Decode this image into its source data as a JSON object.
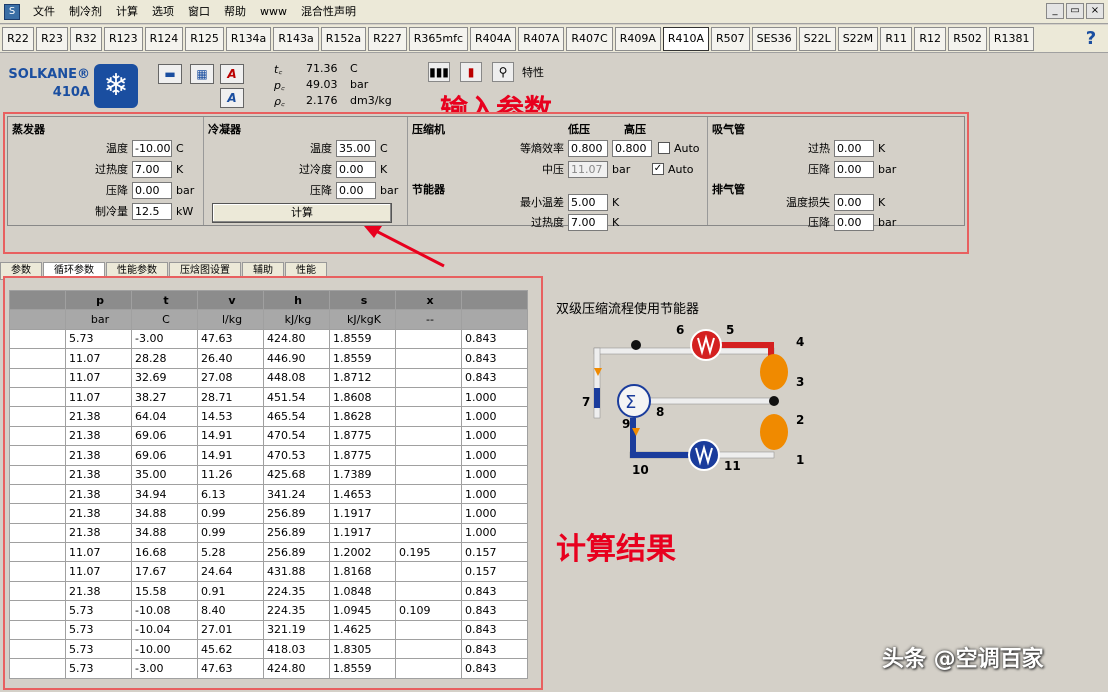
{
  "menu": {
    "items": [
      "文件",
      "制冷剂",
      "计算",
      "选项",
      "窗口",
      "帮助",
      "www",
      "混合性声明"
    ],
    "window_buttons": [
      "_",
      "▭",
      "×"
    ]
  },
  "refrigerants": {
    "tabs": [
      "R22",
      "R23",
      "R32",
      "R123",
      "R124",
      "R125",
      "R134a",
      "R143a",
      "R152a",
      "R227",
      "R365mfc",
      "R404A",
      "R407A",
      "R407C",
      "R409A",
      "R410A",
      "R507",
      "SES36",
      "S22L",
      "S22M",
      "R11",
      "R12",
      "R502",
      "R1381"
    ],
    "active": "R410A",
    "help": "?"
  },
  "header": {
    "brand": "SOLKANE®",
    "model": "410A",
    "logo_glyph": "❄",
    "props": [
      {
        "sym": "t꜀",
        "val": "71.36",
        "unit": "C"
      },
      {
        "sym": "p꜀",
        "val": "49.03",
        "unit": "bar"
      },
      {
        "sym": "ρ꜀",
        "val": "2.176",
        "unit": "dm3/kg"
      }
    ],
    "right_label": "特性"
  },
  "annotations": {
    "input": "输入参数",
    "result": "计算结果"
  },
  "input": {
    "evaporator": {
      "title": "蒸发器",
      "fields": [
        {
          "label": "温度",
          "value": "-10.00",
          "unit": "C"
        },
        {
          "label": "过热度",
          "value": "7.00",
          "unit": "K"
        },
        {
          "label": "压降",
          "value": "0.00",
          "unit": "bar"
        },
        {
          "label": "制冷量",
          "value": "12.5",
          "unit": "kW"
        }
      ]
    },
    "condenser": {
      "title": "冷凝器",
      "fields": [
        {
          "label": "温度",
          "value": "35.00",
          "unit": "C"
        },
        {
          "label": "过冷度",
          "value": "0.00",
          "unit": "K"
        },
        {
          "label": "压降",
          "value": "0.00",
          "unit": "bar"
        }
      ],
      "calc_button": "计算"
    },
    "compressor": {
      "title": "压缩机",
      "low_label": "低压",
      "high_label": "高压",
      "efficiency_label": "等熵效率",
      "low_value": "0.800",
      "high_value": "0.800",
      "auto1": "Auto",
      "mid_label": "中压",
      "mid_value": "11.07",
      "mid_unit": "bar",
      "auto2": "Auto"
    },
    "economizer": {
      "title": "节能器",
      "fields": [
        {
          "label": "最小温差",
          "value": "5.00",
          "unit": "K"
        },
        {
          "label": "过热度",
          "value": "7.00",
          "unit": "K"
        }
      ]
    },
    "suction": {
      "title": "吸气管",
      "fields": [
        {
          "label": "过热",
          "value": "0.00",
          "unit": "K"
        },
        {
          "label": "压降",
          "value": "0.00",
          "unit": "bar"
        }
      ]
    },
    "discharge": {
      "title": "排气管",
      "fields": [
        {
          "label": "温度损失",
          "value": "0.00",
          "unit": "K"
        },
        {
          "label": "压降",
          "value": "0.00",
          "unit": "bar"
        }
      ]
    }
  },
  "result_tabs": [
    "参数",
    "循环参数",
    "性能参数",
    "压焓图设置",
    "辅助",
    "性能"
  ],
  "result_tab_active": 1,
  "table": {
    "headers": [
      "",
      "p",
      "t",
      "v",
      "h",
      "s",
      "x",
      ""
    ],
    "units": [
      "",
      "bar",
      "C",
      "l/kg",
      "kJ/kg",
      "kJ/kgK",
      "--",
      ""
    ],
    "rows": [
      [
        "",
        "5.73",
        "-3.00",
        "47.63",
        "424.80",
        "1.8559",
        "",
        "0.843"
      ],
      [
        "",
        "11.07",
        "28.28",
        "26.40",
        "446.90",
        "1.8559",
        "",
        "0.843"
      ],
      [
        "",
        "11.07",
        "32.69",
        "27.08",
        "448.08",
        "1.8712",
        "",
        "0.843"
      ],
      [
        "",
        "11.07",
        "38.27",
        "28.71",
        "451.54",
        "1.8608",
        "",
        "1.000"
      ],
      [
        "",
        "21.38",
        "64.04",
        "14.53",
        "465.54",
        "1.8628",
        "",
        "1.000"
      ],
      [
        "",
        "21.38",
        "69.06",
        "14.91",
        "470.54",
        "1.8775",
        "",
        "1.000"
      ],
      [
        "",
        "21.38",
        "69.06",
        "14.91",
        "470.53",
        "1.8775",
        "",
        "1.000"
      ],
      [
        "",
        "21.38",
        "35.00",
        "11.26",
        "425.68",
        "1.7389",
        "",
        "1.000"
      ],
      [
        "",
        "21.38",
        "34.94",
        "6.13",
        "341.24",
        "1.4653",
        "",
        "1.000"
      ],
      [
        "",
        "21.38",
        "34.88",
        "0.99",
        "256.89",
        "1.1917",
        "",
        "1.000"
      ],
      [
        "",
        "21.38",
        "34.88",
        "0.99",
        "256.89",
        "1.1917",
        "",
        "1.000"
      ],
      [
        "",
        "11.07",
        "16.68",
        "5.28",
        "256.89",
        "1.2002",
        "0.195",
        "0.157"
      ],
      [
        "",
        "11.07",
        "17.67",
        "24.64",
        "431.88",
        "1.8168",
        "",
        "0.157"
      ],
      [
        "",
        "21.38",
        "15.58",
        "0.91",
        "224.35",
        "1.0848",
        "",
        "0.843"
      ],
      [
        "",
        "5.73",
        "-10.08",
        "8.40",
        "224.35",
        "1.0945",
        "0.109",
        "0.843"
      ],
      [
        "",
        "5.73",
        "-10.04",
        "27.01",
        "321.19",
        "1.4625",
        "",
        "0.843"
      ],
      [
        "",
        "5.73",
        "-10.00",
        "45.62",
        "418.03",
        "1.8305",
        "",
        "0.843"
      ],
      [
        "",
        "5.73",
        "-3.00",
        "47.63",
        "424.80",
        "1.8559",
        "",
        "0.843"
      ]
    ]
  },
  "diagram": {
    "title": "双级压缩流程使用节能器",
    "points": [
      "1",
      "2",
      "3",
      "4",
      "5",
      "6",
      "7",
      "8",
      "9",
      "10",
      "11"
    ],
    "colors": {
      "hot": "#d42020",
      "cold": "#1a3c9c",
      "pipe": "#f0f0f0",
      "compressor": "#f08a00"
    }
  },
  "watermark": "头条 @空调百家"
}
